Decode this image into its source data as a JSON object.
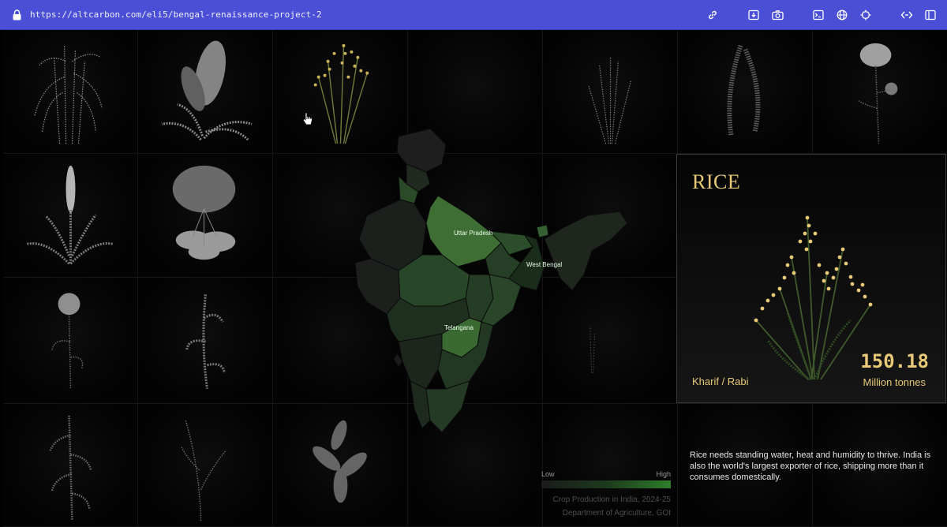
{
  "browser": {
    "url": "https://altcarbon.com/eli5/bengal-renaissance-project-2",
    "icons": [
      "lock-icon",
      "link-icon",
      "download-icon",
      "camera-icon",
      "terminal-icon",
      "globe-icon",
      "crosshair-icon",
      "code-icon",
      "sidebar-icon"
    ]
  },
  "map": {
    "labels": {
      "uttar_pradesh": "Uttar Pradesh",
      "west_bengal": "West Bengal",
      "telangana": "Telangana"
    },
    "legend": {
      "low": "Low",
      "high": "High"
    },
    "source_title": "Crop Production in India, 2024-25",
    "source_org": "Department of Agriculture, GOI",
    "colors": {
      "low": "#1a1a1a",
      "high": "#2f7d2b"
    }
  },
  "card": {
    "title": "RICE",
    "season": "Kharif / Rabi",
    "value": "150.18",
    "unit": "Million tonnes",
    "accent": "#e7c977"
  },
  "description": "Rice needs standing water, heat and humidity to thrive. India is also the world's largest exporter of rice, shipping more than it consumes domestically."
}
